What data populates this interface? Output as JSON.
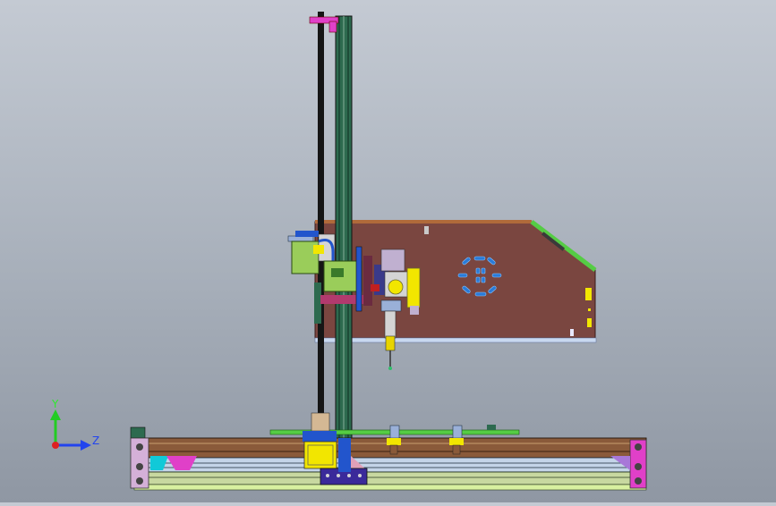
{
  "triad": {
    "y_label": "Y",
    "z_label": "Z",
    "y_color": "#22cc22",
    "z_color": "#2244ee",
    "origin_color": "#dd2222"
  },
  "colors": {
    "background_top": "#c4cad3",
    "background_bottom": "#8f97a3",
    "plate": "#7a4640",
    "rail": "#2d6a4f",
    "accent_magenta": "#e040c8",
    "accent_yellow": "#f2e600",
    "accent_blue": "#2255cc",
    "accent_green": "#55cc44"
  }
}
